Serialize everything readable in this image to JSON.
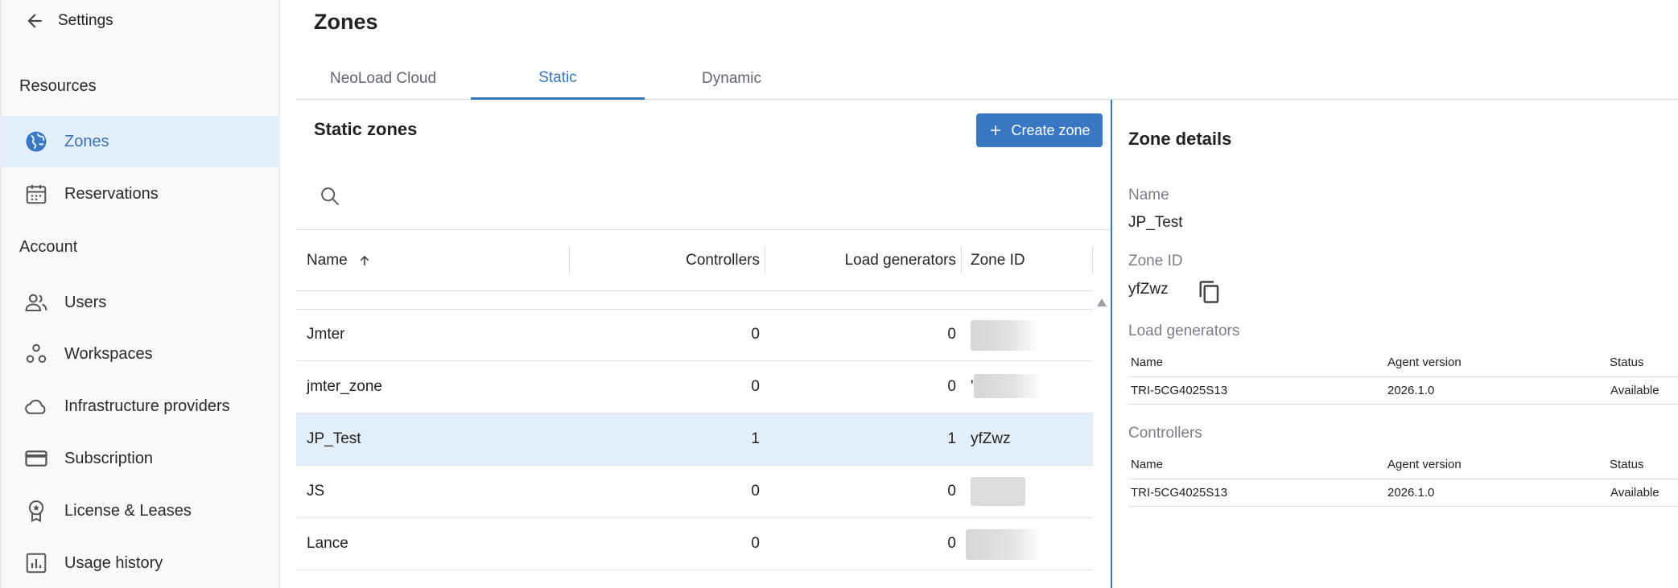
{
  "sidebar": {
    "back_label": "Settings",
    "section_resources": "Resources",
    "section_account": "Account",
    "items": [
      {
        "label": "Zones",
        "icon": "globe-icon"
      },
      {
        "label": "Reservations",
        "icon": "calendar-icon"
      },
      {
        "label": "Users",
        "icon": "users-icon"
      },
      {
        "label": "Workspaces",
        "icon": "workspaces-icon"
      },
      {
        "label": "Infrastructure providers",
        "icon": "cloud-icon"
      },
      {
        "label": "Subscription",
        "icon": "credit-card-icon"
      },
      {
        "label": "License & Leases",
        "icon": "badge-icon"
      },
      {
        "label": "Usage history",
        "icon": "chart-icon"
      }
    ]
  },
  "page": {
    "title": "Zones",
    "tabs": [
      "NeoLoad Cloud",
      "Static",
      "Dynamic"
    ],
    "active_tab": "Static"
  },
  "list": {
    "title": "Static zones",
    "create_label": "Create zone",
    "columns": [
      "Name",
      "Controllers",
      "Load generators",
      "Zone ID"
    ],
    "sort_column": "Name",
    "sort_direction": "ascending",
    "rows": [
      {
        "name": "Jmter",
        "controllers": "0",
        "load_generators": "0",
        "zone_id": ""
      },
      {
        "name": "jmter_zone",
        "controllers": "0",
        "load_generators": "0",
        "zone_id": "'"
      },
      {
        "name": "JP_Test",
        "controllers": "1",
        "load_generators": "1",
        "zone_id": "yfZwz"
      },
      {
        "name": "JS",
        "controllers": "0",
        "load_generators": "0",
        "zone_id": ""
      },
      {
        "name": "Lance",
        "controllers": "0",
        "load_generators": "0",
        "zone_id": ""
      }
    ]
  },
  "details": {
    "title": "Zone details",
    "name_label": "Name",
    "name_value": "JP_Test",
    "zone_id_label": "Zone ID",
    "zone_id_value": "yfZwz",
    "load_generators_label": "Load generators",
    "controllers_label": "Controllers",
    "table_columns": [
      "Name",
      "Agent version",
      "Status"
    ],
    "load_generators": [
      {
        "name": "TRI-5CG4025S13",
        "version": "2026.1.0",
        "status": "Available"
      }
    ],
    "controllers": [
      {
        "name": "TRI-5CG4025S13",
        "version": "2026.1.0",
        "status": "Available"
      }
    ]
  },
  "colors": {
    "accent": "#3a77c2",
    "selected_bg": "#e3eefb"
  }
}
